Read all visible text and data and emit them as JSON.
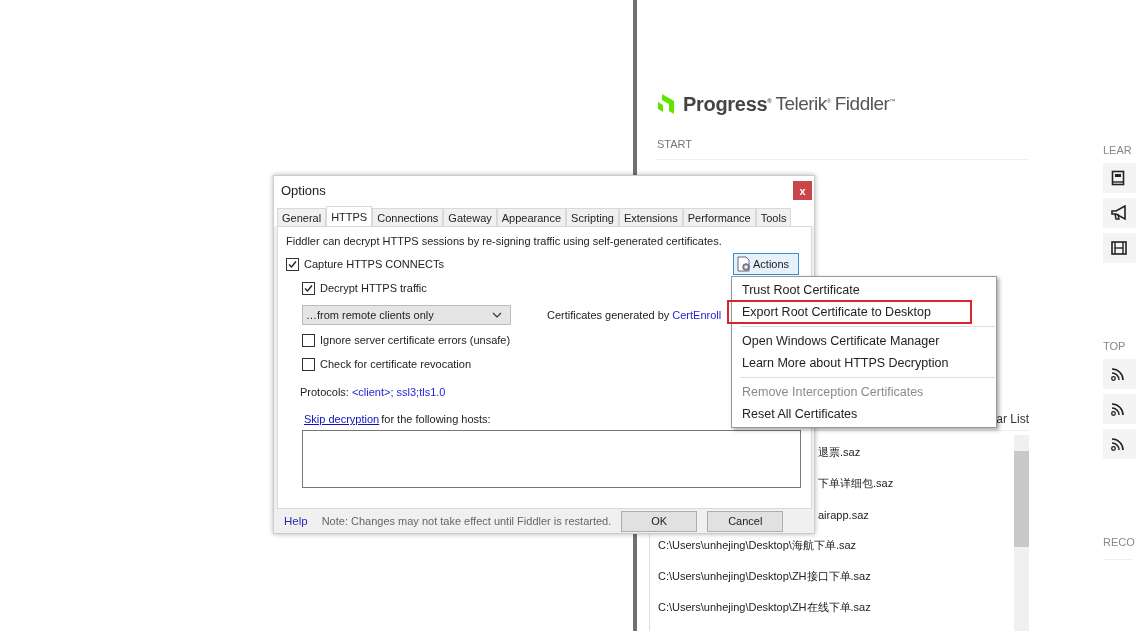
{
  "start_page": {
    "logo": {
      "brand": "Progress$^{®}$",
      "product": "Telerik$^{®}$",
      "name": "Fiddler$^{™}$"
    },
    "start_label": "START",
    "recent_header": "ar List",
    "recent_files": [
      {
        "text": "退票.saz",
        "kind": "partial"
      },
      {
        "text": "下单详细包.saz",
        "kind": "partial"
      },
      {
        "text": "airapp.saz",
        "kind": "partial"
      },
      {
        "text": "C:\\Users\\unhejing\\Desktop\\海航下单.saz",
        "kind": "full"
      },
      {
        "text": "C:\\Users\\unhejing\\Desktop\\ZH接口下单.saz",
        "kind": "full"
      },
      {
        "text": "C:\\Users\\unhejing\\Desktop\\ZH在线下单.saz",
        "kind": "full"
      }
    ],
    "side_sections": [
      {
        "title": "LEAR",
        "icons": [
          {
            "kind": "book"
          },
          {
            "kind": "megaphone"
          },
          {
            "kind": "film"
          }
        ]
      },
      {
        "title": "TOP",
        "icons": [
          {
            "kind": "rss"
          },
          {
            "kind": "rss"
          },
          {
            "kind": "rss"
          }
        ]
      },
      {
        "title": "RECO"
      }
    ]
  },
  "dialog": {
    "title": "Options",
    "close_label": "x",
    "tabs": [
      {
        "label": "General",
        "selected": false
      },
      {
        "label": "HTTPS",
        "selected": true
      },
      {
        "label": "Connections",
        "selected": false
      },
      {
        "label": "Gateway",
        "selected": false
      },
      {
        "label": "Appearance",
        "selected": false
      },
      {
        "label": "Scripting",
        "selected": false
      },
      {
        "label": "Extensions",
        "selected": false
      },
      {
        "label": "Performance",
        "selected": false
      },
      {
        "label": "Tools",
        "selected": false
      }
    ],
    "description": "Fiddler can decrypt HTTPS sessions by re-signing traffic using self-generated certificates.",
    "capture": {
      "label": "Capture HTTPS CONNECTs",
      "checked": true
    },
    "actions_button": "Actions",
    "decrypt": {
      "label": "Decrypt HTTPS traffic",
      "checked": true
    },
    "source_dropdown": {
      "value": "…from remote clients only"
    },
    "certificates_text": "Certificates generated by",
    "certificates_link": "CertEnroll",
    "ignore_errors": {
      "label": "Ignore server certificate errors (unsafe)",
      "checked": false
    },
    "revocation": {
      "label": "Check for certificate revocation",
      "checked": false
    },
    "protocols_label": "Protocols:",
    "protocols_link": "<client>; ssl3;tls1.0",
    "skip_link": "Skip decryption",
    "skip_text": "for the following hosts:",
    "help_link": "Help",
    "note": "Note: Changes may not take effect until Fiddler is restarted.",
    "ok_button": "OK",
    "cancel_button": "Cancel"
  },
  "actions_menu": [
    {
      "kind": "item",
      "label": "Trust Root Certificate",
      "disabled": false,
      "outlined": false
    },
    {
      "kind": "item",
      "label": "Export Root Certificate to Desktop",
      "disabled": false,
      "outlined": true
    },
    {
      "kind": "separator"
    },
    {
      "kind": "item",
      "label": "Open Windows Certificate Manager",
      "disabled": false,
      "outlined": false
    },
    {
      "kind": "item",
      "label": "Learn More about HTTPS Decryption",
      "disabled": false,
      "outlined": false
    },
    {
      "kind": "separator"
    },
    {
      "kind": "item",
      "label": "Remove Interception Certificates",
      "disabled": true,
      "outlined": false
    },
    {
      "kind": "item",
      "label": "Reset All Certificates",
      "disabled": false,
      "outlined": false
    }
  ]
}
